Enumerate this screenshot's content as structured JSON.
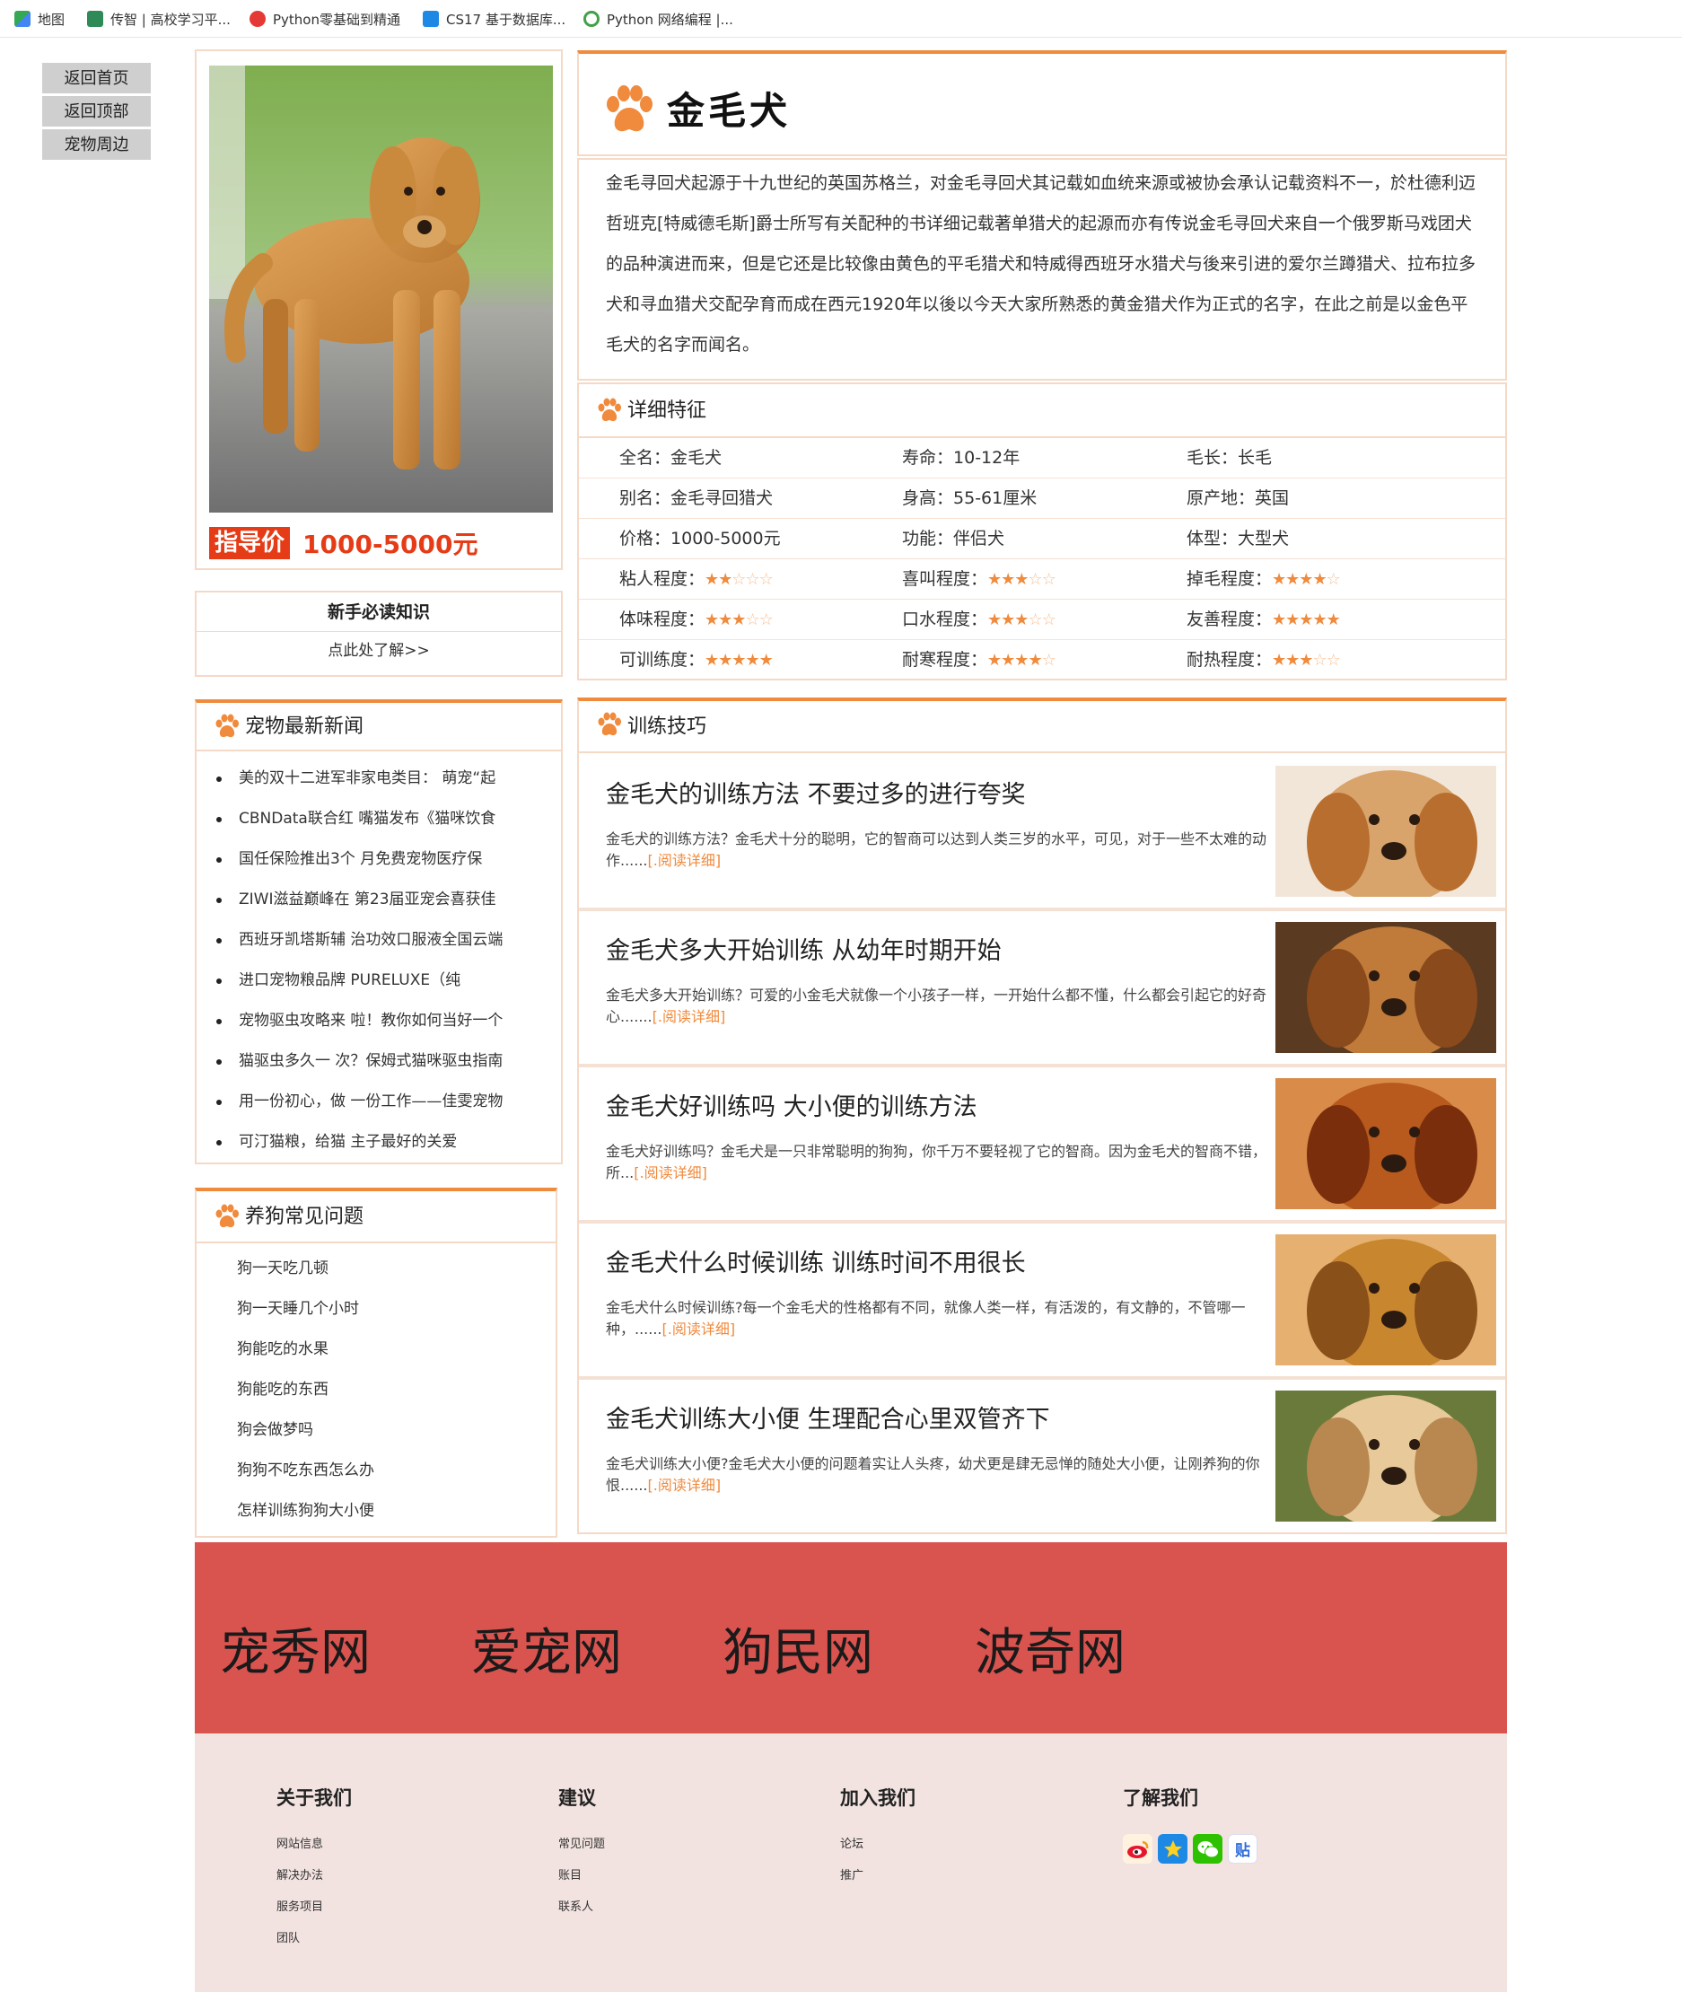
{
  "bookmarks": [
    {
      "label": "地图",
      "color": "#34a853"
    },
    {
      "label": "传智 | 高校学习平...",
      "color": "#2e8b57"
    },
    {
      "label": "Python零基础到精通",
      "color": "#e53935"
    },
    {
      "label": "CS17 基于数据库...",
      "color": "#1e88e5"
    },
    {
      "label": "Python 网络编程 |...",
      "color": "#43a047"
    }
  ],
  "sidenav": [
    "返回首页",
    "返回顶部",
    "宠物周边"
  ],
  "price": {
    "tag": "指导价",
    "value": "1000-5000元"
  },
  "read_box": {
    "title": "新手必读知识",
    "link": "点此处了解>>"
  },
  "breed": {
    "name": "金毛犬",
    "intro": "金毛寻回犬起源于十九世纪的英国苏格兰，对金毛寻回犬其记载如血统来源或被协会承认记载资料不一，於杜德利迈哲班克[特威德毛斯]爵士所写有关配种的书详细记载著单猎犬的起源而亦有传说金毛寻回犬来自一个俄罗斯马戏团犬的品种演进而来，但是它还是比较像由黄色的平毛猎犬和特威得西班牙水猎犬与後来引进的爱尔兰蹲猎犬、拉布拉多犬和寻血猎犬交配孕育而成在西元1920年以後以今天大家所熟悉的黄金猎犬作为正式的名字，在此之前是以金色平毛犬的名字而闻名。"
  },
  "features": {
    "heading": "详细特征",
    "rows": [
      [
        {
          "k": "全名：",
          "v": "金毛犬"
        },
        {
          "k": "寿命：",
          "v": "10-12年"
        },
        {
          "k": "毛长：",
          "v": "长毛"
        }
      ],
      [
        {
          "k": "别名：",
          "v": "金毛寻回猎犬"
        },
        {
          "k": "身高：",
          "v": "55-61厘米"
        },
        {
          "k": "原产地：",
          "v": "英国"
        }
      ],
      [
        {
          "k": "价格：",
          "v": "1000-5000元"
        },
        {
          "k": "功能：",
          "v": "伴侣犬"
        },
        {
          "k": "体型：",
          "v": "大型犬"
        }
      ]
    ],
    "ratings": [
      [
        {
          "k": "粘人程度：",
          "stars": 2
        },
        {
          "k": "喜叫程度：",
          "stars": 3
        },
        {
          "k": "掉毛程度：",
          "stars": 4
        }
      ],
      [
        {
          "k": "体味程度：",
          "stars": 3
        },
        {
          "k": "口水程度：",
          "stars": 3
        },
        {
          "k": "友善程度：",
          "stars": 5
        }
      ],
      [
        {
          "k": "可训练度：",
          "stars": 5
        },
        {
          "k": "耐寒程度：",
          "stars": 4
        },
        {
          "k": "耐热程度：",
          "stars": 3
        }
      ]
    ]
  },
  "news": {
    "heading": "宠物最新新闻",
    "items": [
      "美的双十二进军非家电类目： 萌宠“起",
      "CBNData联合红 嘴猫发布《猫咪饮食",
      "国任保险推出3个 月免费宠物医疗保",
      "ZIWI滋益巅峰在 第23届亚宠会喜获佳",
      "西班牙凯塔斯辅 治功效口服液全国云端",
      "进口宠物粮品牌 PURELUXE（纯",
      "宠物驱虫攻略来 啦！教你如何当好一个",
      "猫驱虫多久一 次？保姆式猫咪驱虫指南",
      "用一份初心，做 一份工作——佳雯宠物",
      "可汀猫粮，给猫 主子最好的关爱"
    ]
  },
  "faq": {
    "heading": "养狗常见问题",
    "items": [
      "狗一天吃几顿",
      "狗一天睡几个小时",
      "狗能吃的水果",
      "狗能吃的东西",
      "狗会做梦吗",
      "狗狗不吃东西怎么办",
      "怎样训练狗狗大小便"
    ]
  },
  "training": {
    "heading": "训练技巧",
    "more": "[.阅读详细]",
    "items": [
      {
        "title": "金毛犬的训练方法 不要过多的进行夸奖",
        "desc": "金毛犬的训练方法？金毛犬十分的聪明，它的智商可以达到人类三岁的水平，可见，对于一些不太难的动作......"
      },
      {
        "title": "金毛犬多大开始训练 从幼年时期开始",
        "desc": "金毛犬多大开始训练？可爱的小金毛犬就像一个小孩子一样，一开始什么都不懂，什么都会引起它的好奇心......."
      },
      {
        "title": "金毛犬好训练吗 大小便的训练方法",
        "desc": "金毛犬好训练吗？金毛犬是一只非常聪明的狗狗，你千万不要轻视了它的智商。因为金毛犬的智商不错，所..."
      },
      {
        "title": "金毛犬什么时候训练 训练时间不用很长",
        "desc": "金毛犬什么时候训练?每一个金毛犬的性格都有不同，就像人类一样，有活泼的，有文静的，不管哪一种，......"
      },
      {
        "title": "金毛犬训练大小便 生理配合心里双管齐下",
        "desc": "金毛犬训练大小便?金毛犬大小便的问题着实让人头疼，幼犬更是肆无忌惮的随处大小便，让刚养狗的你恨......"
      }
    ]
  },
  "friend_links": [
    "宠秀网",
    "爱宠网",
    "狗民网",
    "波奇网"
  ],
  "footer": {
    "about": {
      "title": "关于我们",
      "items": [
        "网站信息",
        "解决办法",
        "服务项目",
        "团队"
      ]
    },
    "advice": {
      "title": "建议",
      "items": [
        "常见问题",
        "账目",
        "联系人"
      ]
    },
    "join": {
      "title": "加入我们",
      "items": [
        "论坛",
        "推广"
      ]
    },
    "know": {
      "title": "了解我们",
      "social": [
        "weibo-icon",
        "qzone-icon",
        "wechat-icon",
        "tieba-icon"
      ],
      "tieba_glyph": "贴"
    }
  },
  "colors": {
    "accent": "#f08a3c",
    "price_red": "#e53c17",
    "link_band": "#d9534f",
    "footer_bg": "#f2e3e0",
    "border": "#f5d9c7"
  }
}
